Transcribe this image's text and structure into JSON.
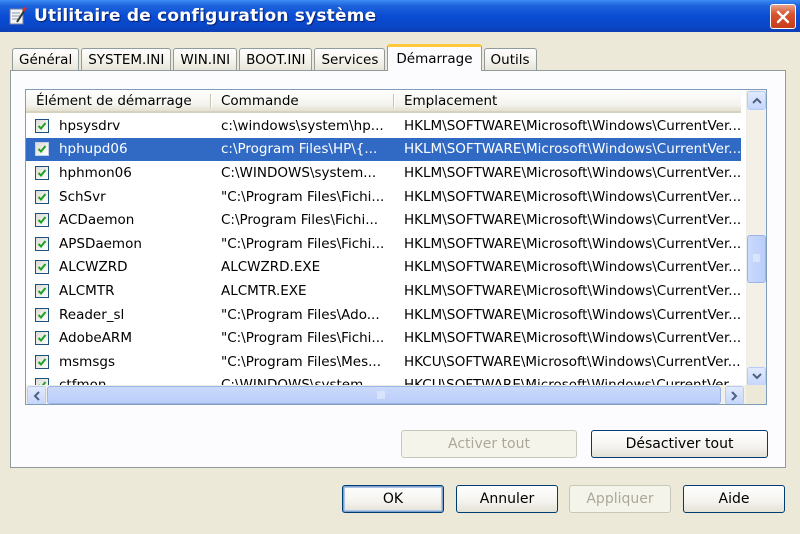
{
  "window": {
    "title": "Utilitaire de configuration système",
    "close_label": "×"
  },
  "tabs": [
    {
      "label": "Général",
      "active": false
    },
    {
      "label": "SYSTEM.INI",
      "active": false
    },
    {
      "label": "WIN.INI",
      "active": false
    },
    {
      "label": "BOOT.INI",
      "active": false
    },
    {
      "label": "Services",
      "active": false
    },
    {
      "label": "Démarrage",
      "active": true
    },
    {
      "label": "Outils",
      "active": false
    }
  ],
  "startup_list": {
    "columns": [
      "Élément de démarrage",
      "Commande",
      "Emplacement"
    ],
    "rows": [
      {
        "checked": true,
        "name": "hpsysdrv",
        "command": "c:\\windows\\system\\hp...",
        "location": "HKLM\\SOFTWARE\\Microsoft\\Windows\\CurrentVer...",
        "selected": false
      },
      {
        "checked": true,
        "name": "hphupd06",
        "command": "c:\\Program Files\\HP\\{...",
        "location": "HKLM\\SOFTWARE\\Microsoft\\Windows\\CurrentVer...",
        "selected": true
      },
      {
        "checked": true,
        "name": "hphmon06",
        "command": "C:\\WINDOWS\\system...",
        "location": "HKLM\\SOFTWARE\\Microsoft\\Windows\\CurrentVer...",
        "selected": false
      },
      {
        "checked": true,
        "name": "SchSvr",
        "command": "\"C:\\Program Files\\Fichi...",
        "location": "HKLM\\SOFTWARE\\Microsoft\\Windows\\CurrentVer...",
        "selected": false
      },
      {
        "checked": true,
        "name": "ACDaemon",
        "command": "C:\\Program Files\\Fichi...",
        "location": "HKLM\\SOFTWARE\\Microsoft\\Windows\\CurrentVer...",
        "selected": false
      },
      {
        "checked": true,
        "name": "APSDaemon",
        "command": "\"C:\\Program Files\\Fichi...",
        "location": "HKLM\\SOFTWARE\\Microsoft\\Windows\\CurrentVer...",
        "selected": false
      },
      {
        "checked": true,
        "name": "ALCWZRD",
        "command": "ALCWZRD.EXE",
        "location": "HKLM\\SOFTWARE\\Microsoft\\Windows\\CurrentVer...",
        "selected": false
      },
      {
        "checked": true,
        "name": "ALCMTR",
        "command": "ALCMTR.EXE",
        "location": "HKLM\\SOFTWARE\\Microsoft\\Windows\\CurrentVer...",
        "selected": false
      },
      {
        "checked": true,
        "name": "Reader_sl",
        "command": "\"C:\\Program Files\\Ado...",
        "location": "HKLM\\SOFTWARE\\Microsoft\\Windows\\CurrentVer...",
        "selected": false
      },
      {
        "checked": true,
        "name": "AdobeARM",
        "command": "\"C:\\Program Files\\Fichi...",
        "location": "HKLM\\SOFTWARE\\Microsoft\\Windows\\CurrentVer...",
        "selected": false
      },
      {
        "checked": true,
        "name": "msmsgs",
        "command": "\"C:\\Program Files\\Mes...",
        "location": "HKCU\\SOFTWARE\\Microsoft\\Windows\\CurrentVer...",
        "selected": false
      },
      {
        "checked": true,
        "name": "ctfmon",
        "command": "C:\\WINDOWS\\system...",
        "location": "HKCU\\SOFTWARE\\Microsoft\\Windows\\CurrentVer...",
        "selected": false
      }
    ]
  },
  "panel_buttons": {
    "enable_all": "Activer tout",
    "disable_all": "Désactiver tout"
  },
  "dialog_buttons": {
    "ok": "OK",
    "cancel": "Annuler",
    "apply": "Appliquer",
    "help": "Aide"
  },
  "colors": {
    "titlebar": "#0A4CD4",
    "selection": "#316AC5",
    "active_tab_accent": "#FFC83C",
    "close_button": "#C63D1A"
  },
  "icons": {
    "title": "msconfig-icon",
    "close": "close-icon",
    "scroll_up": "arrow-up-icon",
    "scroll_down": "arrow-down-icon",
    "scroll_left": "arrow-left-icon",
    "scroll_right": "arrow-right-icon"
  }
}
